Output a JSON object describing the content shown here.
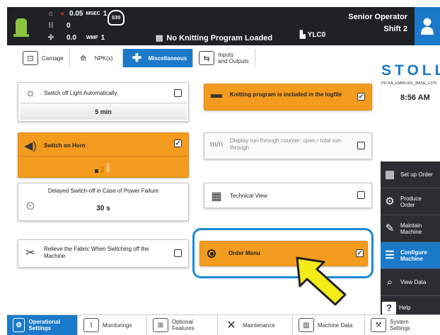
{
  "header": {
    "speed_value": "0.05",
    "speed_unit": "MSEC",
    "speed_count": "1",
    "counter_value": "0",
    "tension_value": "0.0",
    "tension_unit": "WMF",
    "tension_count": "1",
    "s30_label": "S30",
    "program_status": "No Knitting Program Loaded",
    "machine_name": "YLC0",
    "operator_role": "Senior Operator",
    "shift": "Shift 2"
  },
  "tabs": [
    {
      "label": "Carriage",
      "icon": "carriage-icon"
    },
    {
      "label": "NPK(x)",
      "icon": "npk-icon"
    },
    {
      "label": "Miscellaneous",
      "icon": "puzzle-icon"
    },
    {
      "label": "Inputs",
      "label2": "and Outputs",
      "icon": "io-icon"
    }
  ],
  "brand": "STOLL",
  "program_id": "PD-KA_EMMI-001_BASE_1375",
  "clock": "8:56 AM",
  "cards": {
    "light": {
      "label": "Switch off Light Automatically",
      "value": "5 min",
      "checked": false
    },
    "logfile": {
      "label": "Knitting program is included in the logfile",
      "checked": true
    },
    "horn": {
      "label": "Switch on Horn",
      "checked": true,
      "level": 0.6
    },
    "counter": {
      "label": "Display run-through counter: open / total run-through",
      "checked": false
    },
    "power": {
      "label": "Delayed Switch-off in Case of Power Failure",
      "value": "30 s"
    },
    "technical": {
      "label": "Technical View",
      "checked": false
    },
    "fabric": {
      "label": "Relieve the Fabric When Switching off the Machine",
      "checked": false
    },
    "order": {
      "label": "Order Menu",
      "checked": true
    }
  },
  "sidebar": [
    {
      "label": "Set up Order",
      "icon": "setup-order-icon"
    },
    {
      "label": "Produce Order",
      "icon": "produce-order-icon"
    },
    {
      "label": "Maintain Machine",
      "icon": "wrench-icon"
    },
    {
      "label": "Configure Machine",
      "icon": "configure-icon"
    },
    {
      "label": "View Data",
      "icon": "view-data-icon"
    },
    {
      "label": "Help",
      "icon": "help-icon"
    }
  ],
  "bottom_tabs": [
    {
      "label": "Operational Settings",
      "icon": "settings-icon"
    },
    {
      "label": "Monitorings",
      "icon": "monitor-icon"
    },
    {
      "label": "Optional Features",
      "icon": "optional-icon"
    },
    {
      "label": "Maintenance",
      "icon": "maintenance-icon"
    },
    {
      "label": "Machine Data",
      "icon": "machine-data-icon"
    },
    {
      "label": "System Settings",
      "icon": "system-icon"
    }
  ],
  "colors": {
    "accent": "#1a79c8",
    "active_orange": "#f39b1f",
    "header_bg": "#1f2125"
  }
}
